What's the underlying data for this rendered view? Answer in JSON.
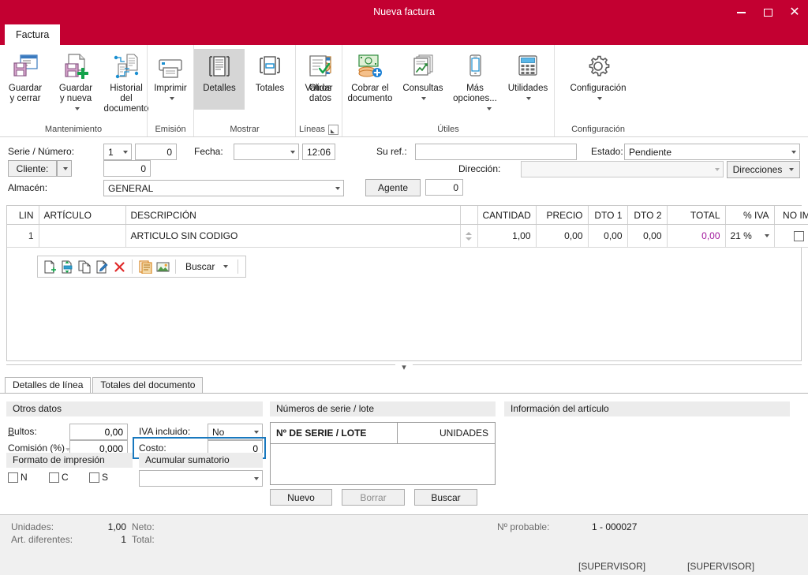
{
  "window": {
    "title": "Nueva factura",
    "accent": "#c30031",
    "minimize_label": "minimize",
    "maximize_label": "maximize",
    "close_label": "close"
  },
  "ribbon": {
    "tab_label": "Factura",
    "groups": [
      {
        "name": "Mantenimiento",
        "label": "Mantenimiento",
        "buttons": [
          {
            "label": "Guardar\ny cerrar",
            "icon": "save-close-icon",
            "has_caret": false,
            "active": false
          },
          {
            "label": "Guardar\ny nueva",
            "icon": "save-new-icon",
            "has_caret": true,
            "active": false
          },
          {
            "label": "Historial del\ndocumento",
            "icon": "history-icon",
            "has_caret": false,
            "active": false
          }
        ]
      },
      {
        "name": "Emision",
        "label": "Emisión",
        "buttons": [
          {
            "label": "Imprimir",
            "icon": "printer-icon",
            "has_caret": true,
            "active": false
          }
        ]
      },
      {
        "name": "Mostrar",
        "label": "Mostrar",
        "buttons": [
          {
            "label": "Detalles",
            "icon": "details-icon",
            "has_caret": false,
            "active": true
          },
          {
            "label": "Totales",
            "icon": "totals-icon",
            "has_caret": false,
            "active": false
          },
          {
            "label": "Otros\ndatos",
            "icon": "other-data-icon",
            "has_caret": false,
            "active": false
          }
        ]
      },
      {
        "name": "Lineas",
        "label": "Líneas",
        "has_dialog_launcher": true,
        "buttons": [
          {
            "label": "Validar",
            "icon": "validate-icon",
            "has_caret": false,
            "active": false
          }
        ]
      },
      {
        "name": "Utiles",
        "label": "Útiles",
        "buttons": [
          {
            "label": "Cobrar el\ndocumento",
            "icon": "money-icon",
            "has_caret": false,
            "active": false
          },
          {
            "label": "Consultas",
            "icon": "queries-icon",
            "has_caret": true,
            "active": false
          },
          {
            "label": "Más\nopciones...",
            "icon": "more-options-icon",
            "has_caret": true,
            "active": false
          },
          {
            "label": "Utilidades",
            "icon": "calculator-icon",
            "has_caret": true,
            "active": false
          }
        ]
      },
      {
        "name": "Configuracion",
        "label": "Configuración",
        "buttons": [
          {
            "label": "Configuración",
            "icon": "gear-icon",
            "has_caret": true,
            "active": false
          }
        ]
      }
    ]
  },
  "form": {
    "serie_numero_label": "Serie / Número:",
    "serie_value": "1",
    "numero_value": "0",
    "fecha_label": "Fecha:",
    "fecha_value": "",
    "hora_value": "12:06",
    "su_ref_label": "Su ref.:",
    "su_ref_value": "",
    "estado_label": "Estado:",
    "estado_value": "Pendiente",
    "cliente_label": "Cliente:",
    "cliente_value": "0",
    "direccion_label": "Dirección:",
    "direccion_value": "",
    "direcciones_button": "Direcciones",
    "almacen_label": "Almacén:",
    "almacen_value": "GENERAL",
    "agente_button": "Agente",
    "agente_value": "0"
  },
  "grid": {
    "columns": [
      "LIN",
      "ARTÍCULO",
      "DESCRIPCIÓN",
      "",
      "CANTIDAD",
      "PRECIO",
      "DTO 1",
      "DTO 2",
      "TOTAL",
      "% IVA",
      "NO IMP."
    ],
    "rows": [
      {
        "lin": "1",
        "articulo": "",
        "descripcion": "ARTICULO SIN CODIGO",
        "cantidad": "1,00",
        "precio": "0,00",
        "dto1": "0,00",
        "dto2": "0,00",
        "total": "0,00",
        "iva": "21 %",
        "no_imp": false
      }
    ],
    "total_color": "#a0149b"
  },
  "line_toolbar": {
    "buttons": [
      {
        "name": "new-line-icon",
        "title": "Nuevo"
      },
      {
        "name": "insert-line-icon",
        "title": "Insertar"
      },
      {
        "name": "copy-line-icon",
        "title": "Copiar"
      },
      {
        "name": "edit-line-icon",
        "title": "Editar"
      },
      {
        "name": "delete-line-icon",
        "title": "Eliminar"
      },
      {
        "name": "note-icon",
        "title": "Nota"
      },
      {
        "name": "image-icon",
        "title": "Imagen"
      }
    ],
    "search_label": "Buscar"
  },
  "lower_tabs": [
    {
      "label": "Detalles de línea",
      "selected": true
    },
    {
      "label": "Totales del documento",
      "selected": false
    }
  ],
  "otros_datos": {
    "section_title": "Otros datos",
    "bultos_label": "Bultos:",
    "bultos_value": "0,00",
    "comision_label": "Comisión (%)",
    "comision_value": "0,000",
    "iva_incluido_label": "IVA incluido:",
    "iva_incluido_value": "No",
    "costo_label": "Costo:",
    "costo_value": "0",
    "formato_title": "Formato de impresión",
    "formato_options": [
      {
        "label": "N",
        "checked": false
      },
      {
        "label": "C",
        "checked": false
      },
      {
        "label": "S",
        "checked": false
      }
    ],
    "acumular_title": "Acumular sumatorio",
    "acumular_value": ""
  },
  "serie_lote": {
    "section_title": "Números de serie / lote",
    "col_serie": "Nº DE SERIE / LOTE",
    "col_unidades": "UNIDADES",
    "rows": [],
    "btn_nuevo": "Nuevo",
    "btn_borrar": "Borrar",
    "btn_buscar": "Buscar"
  },
  "info_articulo": {
    "section_title": "Información del artículo",
    "body": ""
  },
  "status": {
    "unidades_label": "Unidades:",
    "unidades_value": "1,00",
    "neto_label": "Neto:",
    "neto_value": "",
    "art_diferentes_label": "Art. diferentes:",
    "art_diferentes_value": "1",
    "total_label": "Total:",
    "total_value": "",
    "n_probable_label": "Nº probable:",
    "n_probable_value": "1 - 000027",
    "user_left": "[SUPERVISOR]",
    "user_right": "[SUPERVISOR]"
  }
}
